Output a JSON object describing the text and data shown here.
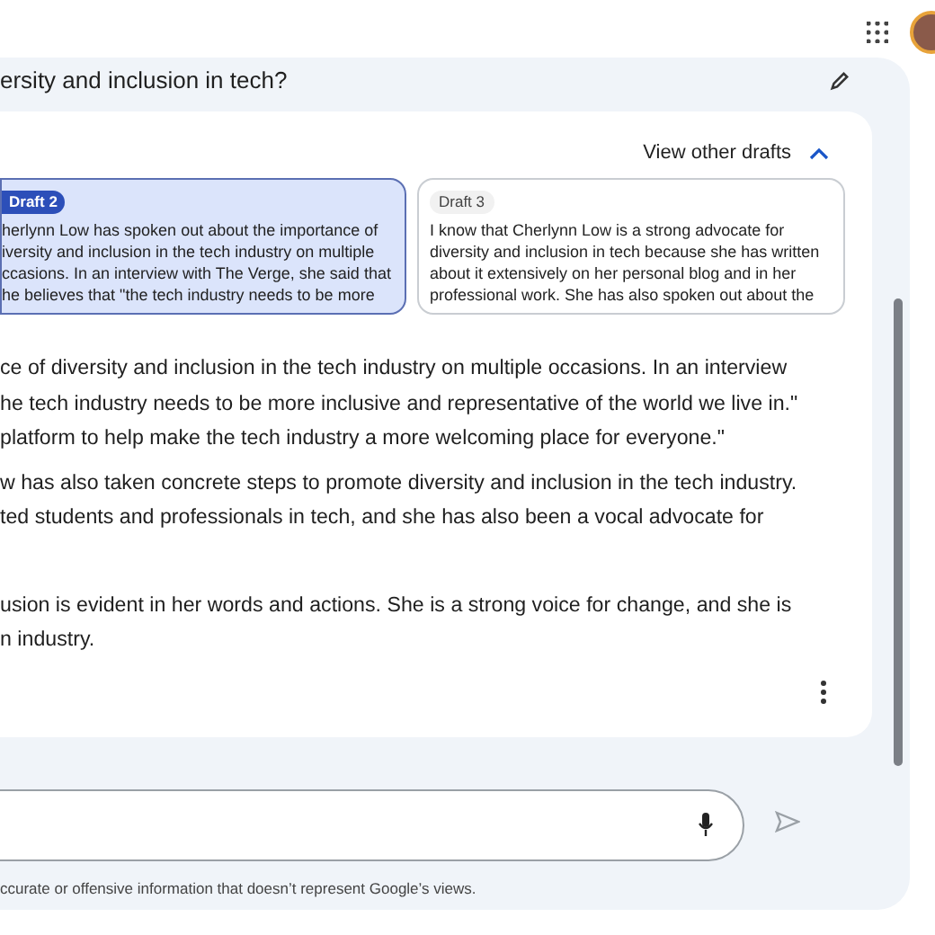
{
  "prompt": {
    "text": "ersity and inclusion in tech?"
  },
  "drafts_toggle": {
    "label": "View other drafts",
    "expanded": true
  },
  "drafts": [
    {
      "label": "Draft 2",
      "selected": true,
      "lines": [
        "herlynn Low has spoken out about the importance of",
        "iversity and inclusion in the tech industry on multiple",
        "ccasions. In an interview with The Verge, she said that",
        "he believes that \"the tech industry needs to be more"
      ]
    },
    {
      "label": "Draft 3",
      "selected": false,
      "lines": [
        "I know that Cherlynn Low is a strong advocate for",
        "diversity and inclusion in tech because she has written",
        "about it extensively on her personal blog and in her",
        "professional work. She has also spoken out about the"
      ]
    }
  ],
  "response": [
    [
      "ce of diversity and inclusion in the tech industry on multiple occasions. In an interview",
      "he tech industry needs to be more inclusive and representative of the world we live in.\"",
      "platform to help make the tech industry a more welcoming place for everyone.\""
    ],
    [
      "w has also taken concrete steps to promote diversity and inclusion in the tech industry.",
      "ted students and professionals in tech, and she has also been a vocal advocate for"
    ],
    [
      "usion is evident in her words and actions. She is a strong voice for change, and she is",
      "n industry."
    ]
  ],
  "disclaimer": "ccurate or offensive information that doesn’t represent Google’s views."
}
